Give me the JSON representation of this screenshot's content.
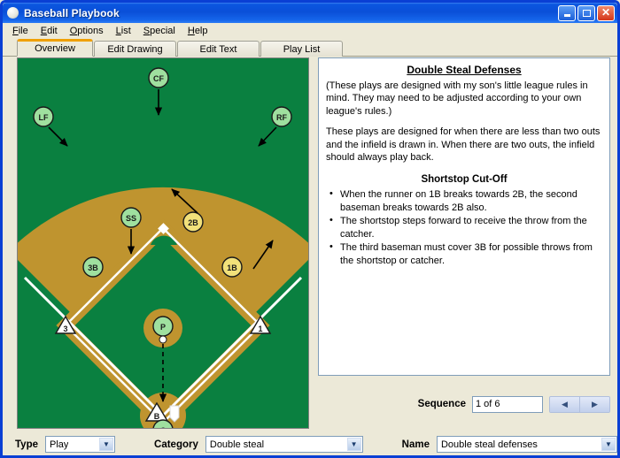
{
  "window": {
    "title": "Baseball Playbook",
    "icon": "baseball-icon",
    "buttons": {
      "minimize": "minimize",
      "maximize": "maximize",
      "close": "close"
    }
  },
  "menubar": {
    "items": [
      {
        "label": "File",
        "accel": "F"
      },
      {
        "label": "Edit",
        "accel": "E"
      },
      {
        "label": "Options",
        "accel": "O"
      },
      {
        "label": "List",
        "accel": "L"
      },
      {
        "label": "Special",
        "accel": "S"
      },
      {
        "label": "Help",
        "accel": "H"
      }
    ]
  },
  "tabs": [
    {
      "label": "Overview",
      "active": true
    },
    {
      "label": "Edit Drawing",
      "active": false
    },
    {
      "label": "Edit Text",
      "active": false
    },
    {
      "label": "Play List",
      "active": false
    }
  ],
  "document": {
    "title": "Double Steal Defenses",
    "paragraphs": [
      "(These plays are designed with my son's little league rules in mind.  They may need to be adjusted according to your own league's rules.)",
      "These plays are designed for when there are less than two outs and the infield is drawn in.  When there are two outs, the infield should always play back."
    ],
    "subheading": "Shortstop Cut-Off",
    "bullets": [
      "When the runner on 1B breaks towards 2B, the second baseman breaks towards 2B also.",
      "The shortstop steps forward to receive the throw from the catcher.",
      "The third baseman must cover 3B for possible throws from the shortstop or catcher."
    ]
  },
  "sequence": {
    "label": "Sequence",
    "value": "1 of 6",
    "current": 1,
    "total": 6,
    "prev_icon": "chevron-left-icon",
    "next_icon": "chevron-right-icon"
  },
  "bottom": {
    "type_label": "Type",
    "type_value": "Play",
    "category_label": "Category",
    "category_value": "Double steal",
    "name_label": "Name",
    "name_value": "Double steal defenses"
  },
  "field": {
    "colors": {
      "grass": "#0a8040",
      "dirt": "#bf942f",
      "line": "#ffffff",
      "player_fill": "#9fe09f",
      "player_moving_fill": "#f2e17a",
      "player_stroke": "#1a1a1a",
      "base_fill": "#ffffff"
    },
    "players": [
      {
        "label": "LF",
        "name": "left-fielder",
        "moving": false
      },
      {
        "label": "CF",
        "name": "center-fielder",
        "moving": false
      },
      {
        "label": "RF",
        "name": "right-fielder",
        "moving": false
      },
      {
        "label": "SS",
        "name": "shortstop",
        "moving": false
      },
      {
        "label": "2B",
        "name": "second-baseman",
        "moving": true
      },
      {
        "label": "3B",
        "name": "third-baseman",
        "moving": false
      },
      {
        "label": "1B",
        "name": "first-baseman",
        "moving": true
      },
      {
        "label": "P",
        "name": "pitcher",
        "moving": false
      },
      {
        "label": "C",
        "name": "catcher",
        "moving": false
      }
    ],
    "bases": [
      {
        "label": "3",
        "name": "third-base"
      },
      {
        "label": "1",
        "name": "first-base"
      },
      {
        "label": "B",
        "name": "batter"
      }
    ]
  }
}
